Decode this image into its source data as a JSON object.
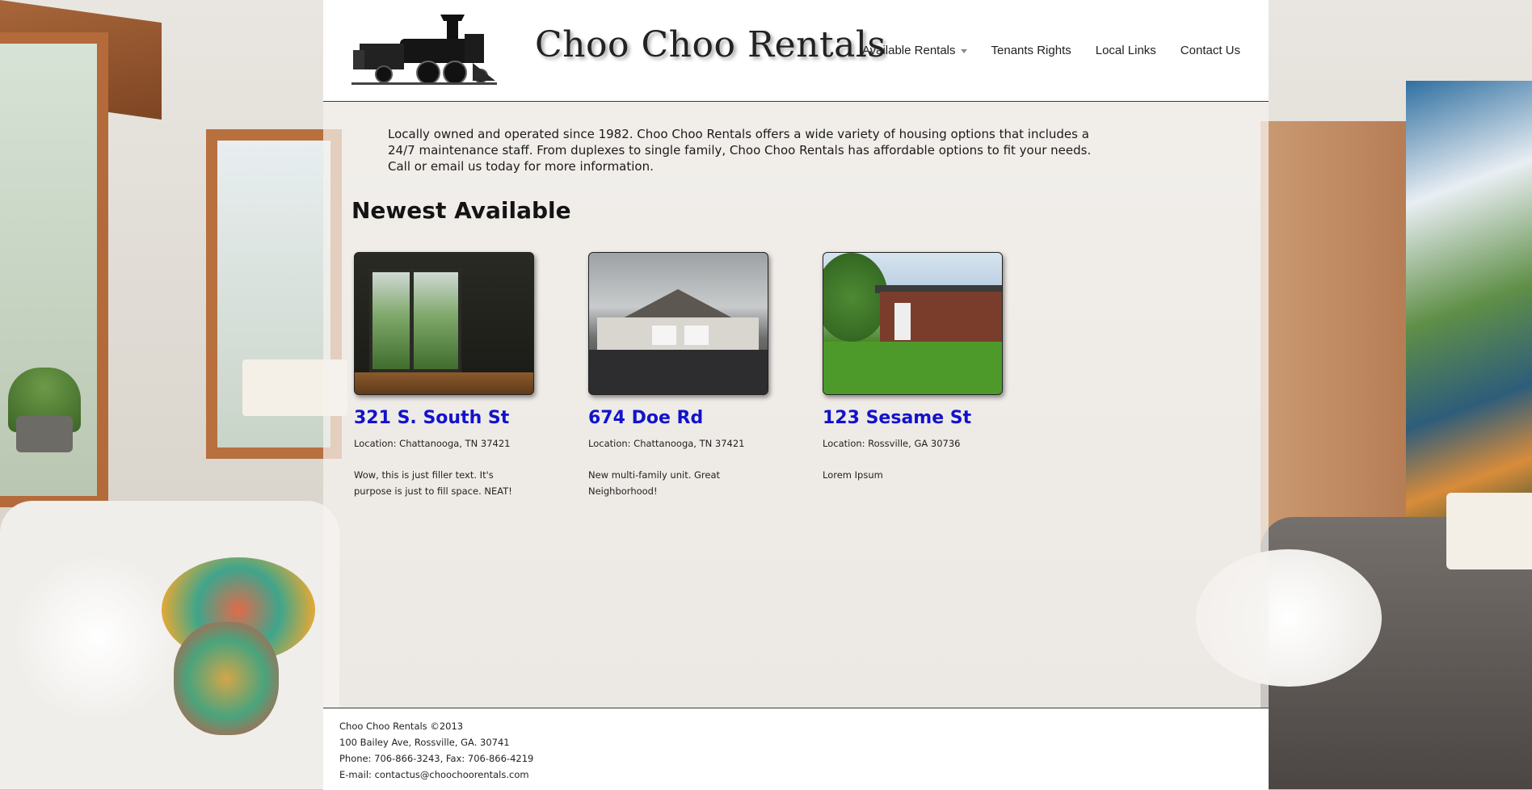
{
  "brand": {
    "name": "Choo Choo Rentals",
    "logo_icon": "locomotive-icon"
  },
  "nav": {
    "items": [
      {
        "label": "Available Rentals",
        "has_dropdown": true
      },
      {
        "label": "Tenants Rights"
      },
      {
        "label": "Local Links"
      },
      {
        "label": "Contact Us"
      }
    ]
  },
  "intro": "Locally owned and operated since 1982. Choo Choo Rentals offers a wide variety of housing options that includes a 24/7 maintenance staff. From duplexes to single family, Choo Choo Rentals has affordable options to fit your needs. Call or email us today for more information.",
  "section_title": "Newest Available",
  "listings": [
    {
      "title": "321 S. South St",
      "location": "Location: Chattanooga, TN 37421",
      "description": "Wow, this is just filler text. It's purpose is just to fill space. NEAT!"
    },
    {
      "title": "674 Doe Rd",
      "location": "Location: Chattanooga, TN 37421",
      "description": "New multi-family unit. Great Neighborhood!"
    },
    {
      "title": "123 Sesame St",
      "location": "Location: Rossville, GA 30736",
      "description": "Lorem Ipsum"
    }
  ],
  "footer": {
    "line1": "Choo Choo Rentals ©2013",
    "line2": "100 Bailey Ave, Rossville, GA. 30741",
    "line3": "Phone: 706-866-3243, Fax: 706-866-4219",
    "line4": "E-mail: contactus@choochoorentals.com"
  },
  "colors": {
    "link": "#1212cc",
    "text": "#222222",
    "header_bg": "#ffffff"
  }
}
